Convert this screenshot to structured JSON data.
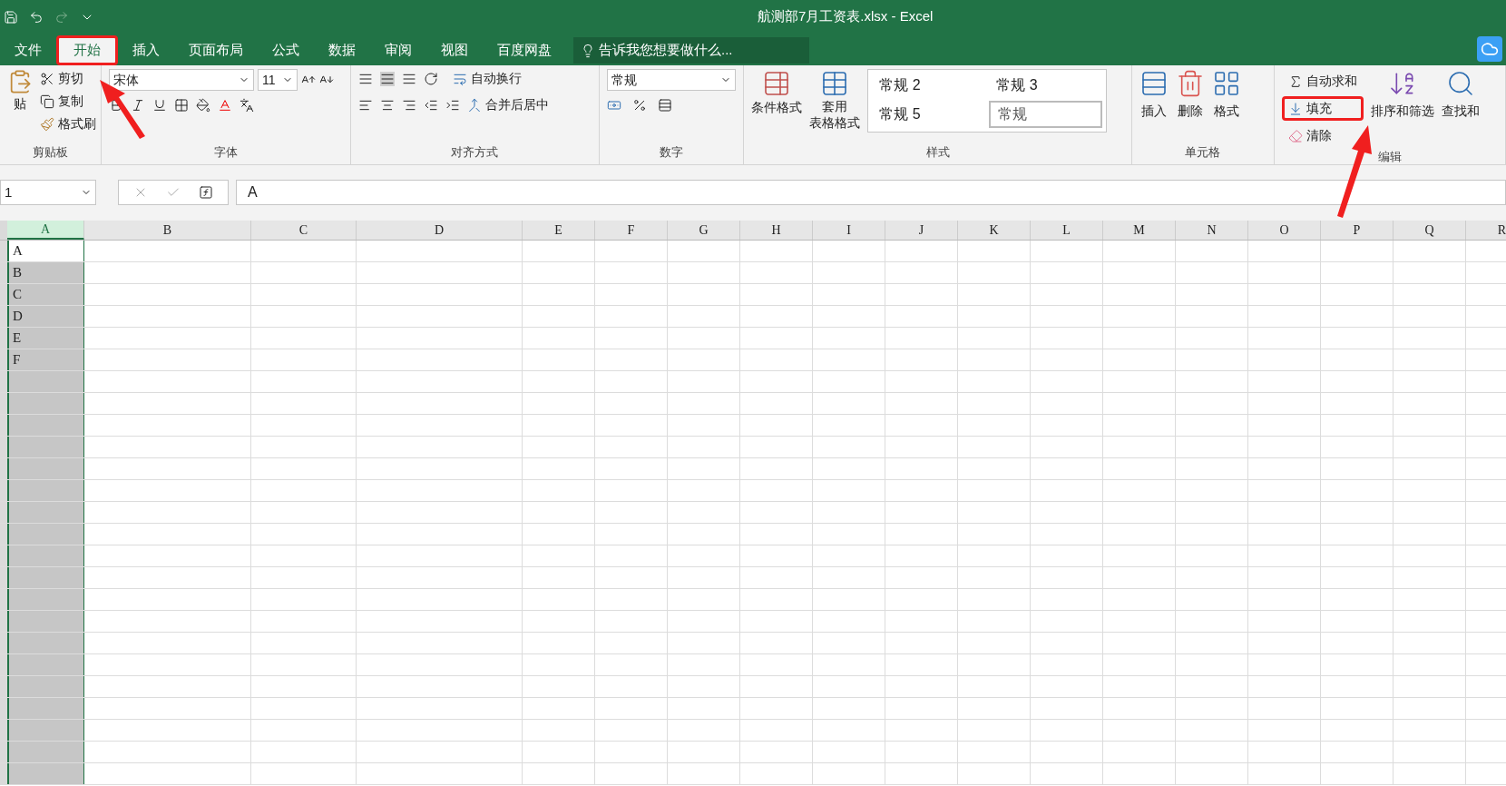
{
  "window": {
    "title": "航测部7月工资表.xlsx - Excel"
  },
  "tabs": [
    {
      "label": "文件",
      "selected": false,
      "annotated": false
    },
    {
      "label": "开始",
      "selected": true,
      "annotated": true
    },
    {
      "label": "插入",
      "selected": false,
      "annotated": false
    },
    {
      "label": "页面布局",
      "selected": false,
      "annotated": false
    },
    {
      "label": "公式",
      "selected": false,
      "annotated": false
    },
    {
      "label": "数据",
      "selected": false,
      "annotated": false
    },
    {
      "label": "审阅",
      "selected": false,
      "annotated": false
    },
    {
      "label": "视图",
      "selected": false,
      "annotated": false
    },
    {
      "label": "百度网盘",
      "selected": false,
      "annotated": false
    }
  ],
  "search": {
    "placeholder": "告诉我您想要做什么..."
  },
  "ribbon": {
    "clipboard": {
      "label": "剪贴板",
      "paste": "贴",
      "items": [
        "剪切",
        "复制",
        "格式刷"
      ]
    },
    "font": {
      "label": "字体",
      "font_name": "宋体",
      "font_size": "11"
    },
    "alignment": {
      "label": "对齐方式",
      "wrap": "自动换行",
      "merge": "合并后居中"
    },
    "number": {
      "label": "数字",
      "format": "常规"
    },
    "styles": {
      "label": "样式",
      "conditional": "条件格式",
      "table_1": "套用",
      "table_2": "表格格式",
      "gallery": [
        {
          "text": "常规 2",
          "selected": false
        },
        {
          "text": "常规 3",
          "selected": false
        },
        {
          "text": "常规 5",
          "selected": false
        },
        {
          "text": "常规",
          "selected": true
        }
      ]
    },
    "cells": {
      "label": "单元格",
      "buttons": [
        "插入",
        "删除",
        "格式"
      ]
    },
    "editing": {
      "label": "编辑",
      "items": [
        {
          "text": "自动求和",
          "annotated": false
        },
        {
          "text": "填充",
          "annotated": true
        },
        {
          "text": "清除",
          "annotated": false
        }
      ],
      "buttons": [
        "排序和筛选",
        "查找和"
      ]
    }
  },
  "formula_bar": {
    "name_box": "1",
    "value": "A"
  },
  "sheet": {
    "columns": [
      {
        "label": "A",
        "selected": true
      },
      {
        "label": "B",
        "selected": false
      },
      {
        "label": "C",
        "selected": false
      },
      {
        "label": "D",
        "selected": false
      },
      {
        "label": "E",
        "selected": false
      },
      {
        "label": "F",
        "selected": false
      },
      {
        "label": "G",
        "selected": false
      },
      {
        "label": "H",
        "selected": false
      },
      {
        "label": "I",
        "selected": false
      },
      {
        "label": "J",
        "selected": false
      },
      {
        "label": "K",
        "selected": false
      },
      {
        "label": "L",
        "selected": false
      },
      {
        "label": "M",
        "selected": false
      },
      {
        "label": "N",
        "selected": false
      },
      {
        "label": "O",
        "selected": false
      },
      {
        "label": "P",
        "selected": false
      },
      {
        "label": "Q",
        "selected": false
      },
      {
        "label": "R",
        "selected": false
      }
    ],
    "cells": [
      "A",
      "B",
      "C",
      "D",
      "E",
      "F"
    ]
  }
}
